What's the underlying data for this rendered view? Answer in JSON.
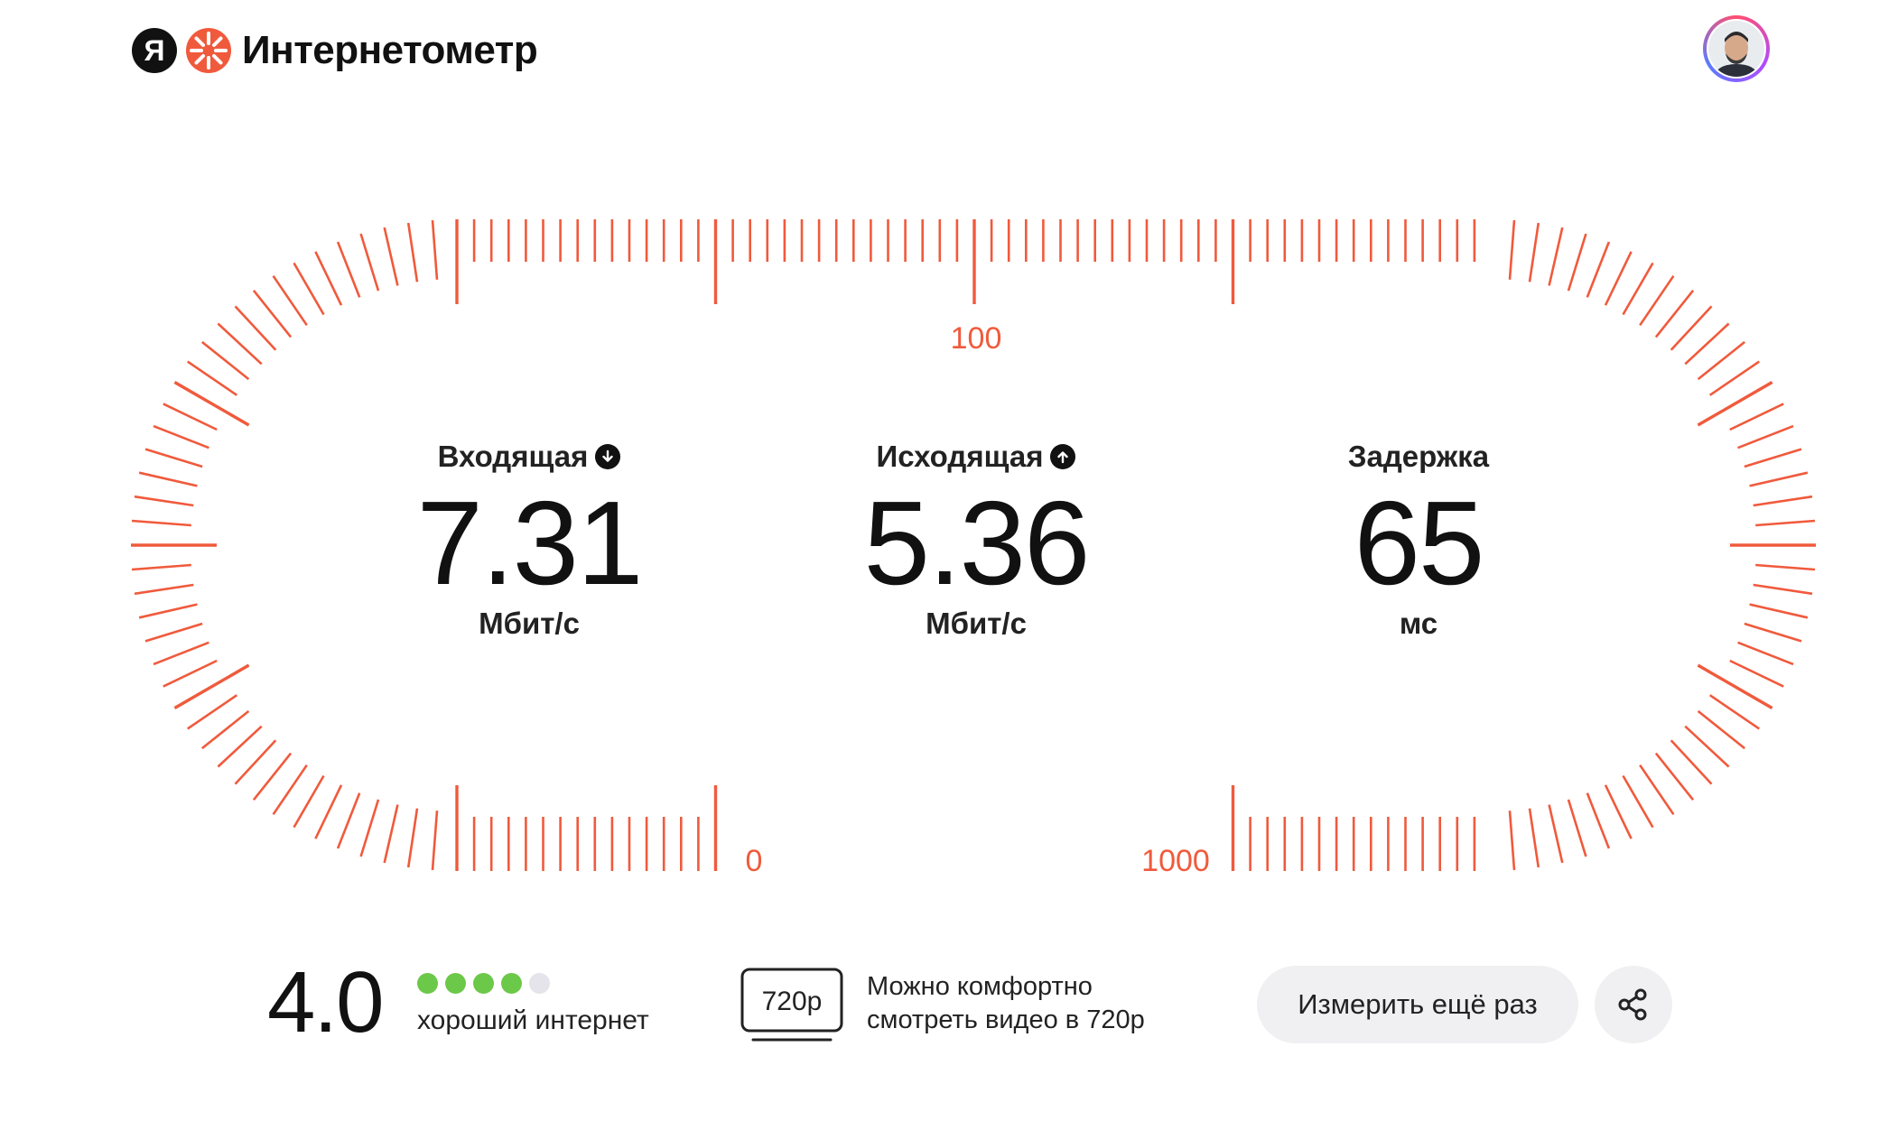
{
  "header": {
    "logo_letter": "Я",
    "title": "Интернетометр"
  },
  "gauge": {
    "color": "#f05a3c",
    "scale_labels": [
      "100",
      "0",
      "1000"
    ]
  },
  "metrics": [
    {
      "label": "Входящая",
      "icon": "arrow-down-icon",
      "value": "7.31",
      "unit": "Мбит/с"
    },
    {
      "label": "Исходящая",
      "icon": "arrow-up-icon",
      "value": "5.36",
      "unit": "Мбит/с"
    },
    {
      "label": "Задержка",
      "icon": "",
      "value": "65",
      "unit": "мс"
    }
  ],
  "rating": {
    "score": "4.0",
    "dots_filled": 4,
    "dots_total": 5,
    "text": "хороший интернет",
    "color_on": "#6cc849",
    "color_off": "#e4e4ea"
  },
  "video": {
    "badge": "720p",
    "text_line1": "Можно комфортно",
    "text_line2": "смотреть видео в 720p"
  },
  "actions": {
    "measure_again": "Измерить ещё раз",
    "share_icon": "share-icon"
  }
}
